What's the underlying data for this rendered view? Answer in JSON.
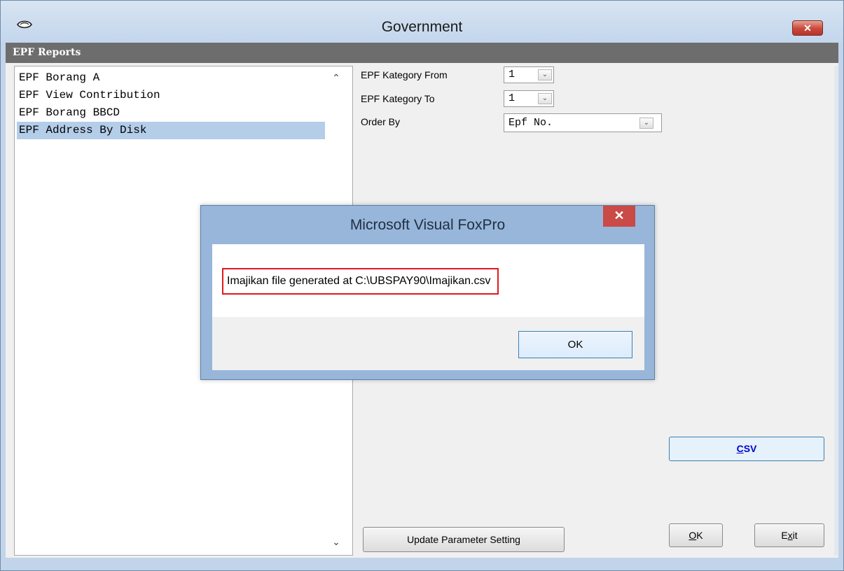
{
  "window": {
    "title": "Government",
    "close_glyph": "✕"
  },
  "section": {
    "header": "EPF Reports"
  },
  "report_list": {
    "items": [
      {
        "label": "EPF Borang A",
        "selected": false
      },
      {
        "label": "EPF View Contribution",
        "selected": false
      },
      {
        "label": "EPF Borang BBCD",
        "selected": false
      },
      {
        "label": "EPF Address By Disk",
        "selected": true
      }
    ],
    "scroll_up_glyph": "⌃",
    "scroll_down_glyph": "⌄"
  },
  "form": {
    "category_from_label": "EPF Kategory From",
    "category_from_value": "1",
    "category_to_label": "EPF Kategory To",
    "category_to_value": "1",
    "order_by_label": "Order By",
    "order_by_value": "Epf No.",
    "dropdown_glyph": "⌄"
  },
  "buttons": {
    "csv_hotkey": "C",
    "csv_rest": "SV",
    "update_parameter": "Update Parameter Setting",
    "ok_hotkey": "O",
    "ok_rest": "K",
    "exit_start": "E",
    "exit_hotkey": "x",
    "exit_rest": "it"
  },
  "dialog": {
    "title": "Microsoft Visual FoxPro",
    "message": "Imajikan file generated at C:\\UBSPAY90\\Imajikan.csv",
    "ok_label": "OK",
    "close_glyph": "✕"
  },
  "colors": {
    "list_selection": "#b4cde9",
    "dialog_frame": "#98b6d9",
    "highlight_border": "#e0191e",
    "csv_text": "#0000cc"
  },
  "icons": {
    "title_icon": "app-icon",
    "close_icon": "close-icon"
  }
}
